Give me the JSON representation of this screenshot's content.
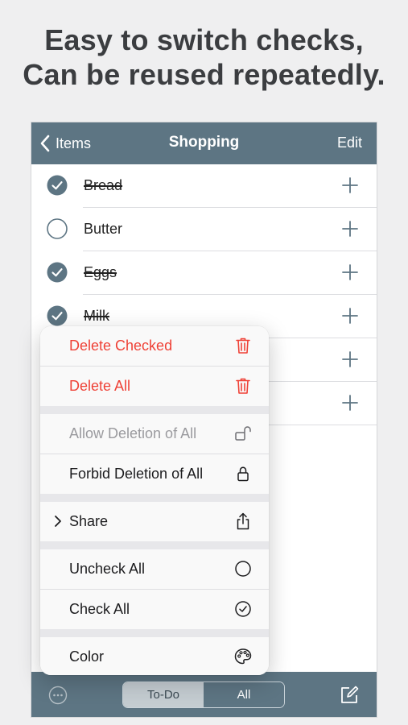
{
  "headline": {
    "line1": "Easy to switch checks,",
    "line2": "Can be reused repeatedly."
  },
  "navbar": {
    "back_label": "Items",
    "title": "Shopping",
    "edit_label": "Edit"
  },
  "items": [
    {
      "label": "Bread",
      "checked": true
    },
    {
      "label": "Butter",
      "checked": false
    },
    {
      "label": "Eggs",
      "checked": true
    },
    {
      "label": "Milk",
      "checked": true
    },
    {
      "label": "",
      "checked": false
    },
    {
      "label": "",
      "checked": false
    }
  ],
  "menu": {
    "delete_checked": "Delete Checked",
    "delete_all": "Delete All",
    "allow_deletion": "Allow Deletion of All",
    "forbid_deletion": "Forbid Deletion of All",
    "share": "Share",
    "uncheck_all": "Uncheck All",
    "check_all": "Check All",
    "color": "Color"
  },
  "toolbar": {
    "todo_label": "To-Do",
    "all_label": "All",
    "selected": "To-Do"
  },
  "colors": {
    "bar": "#5d7583",
    "destructive": "#ef4136",
    "check_fill": "#5d7583"
  }
}
